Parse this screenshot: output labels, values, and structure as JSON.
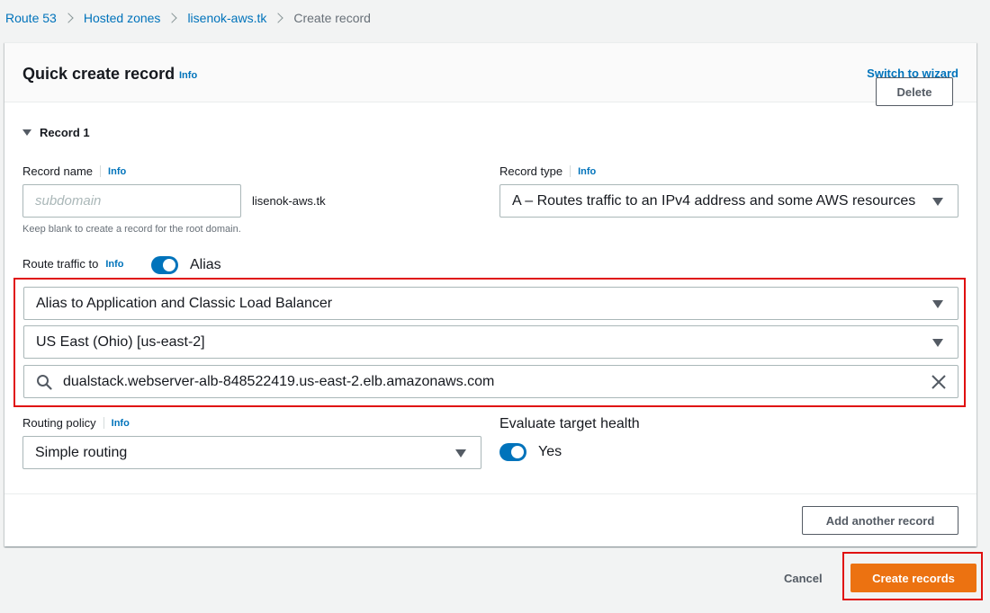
{
  "breadcrumb": {
    "items": [
      "Route 53",
      "Hosted zones",
      "lisenok-aws.tk"
    ],
    "current": "Create record"
  },
  "panel": {
    "title": "Quick create record",
    "info": "Info",
    "switch_link": "Switch to wizard"
  },
  "record": {
    "toggle_label": "Record 1",
    "delete_label": "Delete",
    "name_label": "Record name",
    "name_info": "Info",
    "name_placeholder": "subdomain",
    "domain_suffix": "lisenok-aws.tk",
    "name_hint": "Keep blank to create a record for the root domain.",
    "type_label": "Record type",
    "type_info": "Info",
    "type_value": "A – Routes traffic to an IPv4 address and some AWS resources",
    "route_label": "Route traffic to",
    "route_info": "Info",
    "alias_label": "Alias",
    "alias_on": true,
    "endpoint_value": "Alias to Application and Classic Load Balancer",
    "region_value": "US East (Ohio) [us-east-2]",
    "target_value": "dualstack.webserver-alb-848522419.us-east-2.elb.amazonaws.com",
    "policy_label": "Routing policy",
    "policy_info": "Info",
    "policy_value": "Simple routing",
    "health_label": "Evaluate target health",
    "health_value": "Yes",
    "health_on": true
  },
  "footer": {
    "add_label": "Add another record",
    "cancel_label": "Cancel",
    "create_label": "Create records"
  },
  "colors": {
    "link": "#0073bb",
    "primary": "#ec7211",
    "highlight": "#e01010"
  }
}
